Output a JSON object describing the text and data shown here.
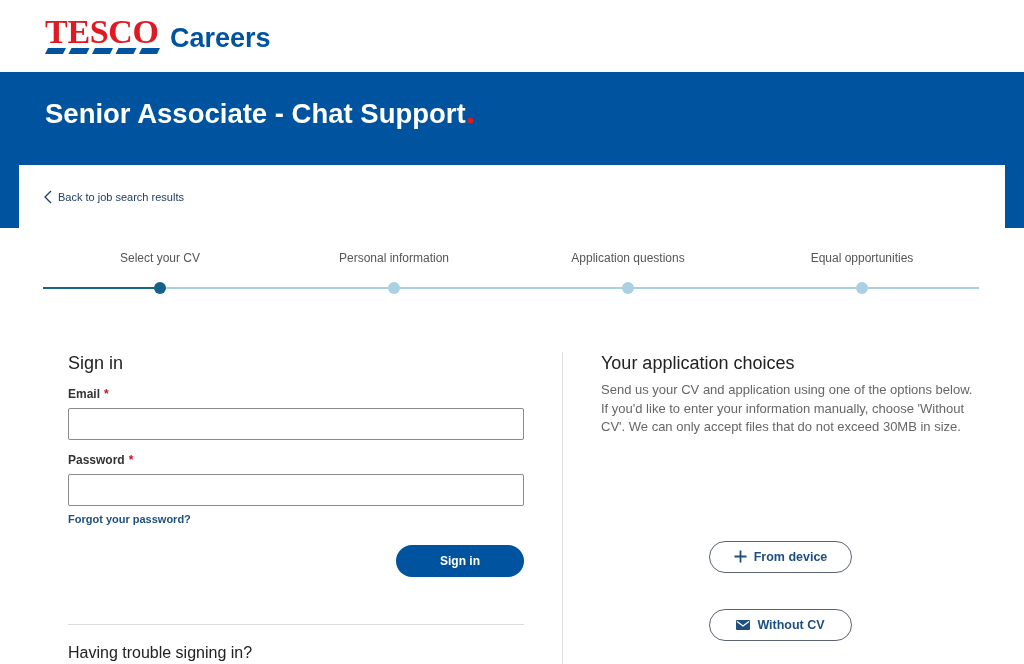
{
  "header": {
    "logo": {
      "brand": "TESCO",
      "site": "Careers"
    }
  },
  "banner": {
    "title": "Senior Associate - Chat Support"
  },
  "back_link": {
    "label": "Back to job search results"
  },
  "steps": [
    {
      "label": "Select your CV",
      "selected": true
    },
    {
      "label": "Personal information",
      "selected": false
    },
    {
      "label": "Application questions",
      "selected": false
    },
    {
      "label": "Equal opportunities",
      "selected": false
    }
  ],
  "sign_in": {
    "heading": "Sign in",
    "fields": [
      {
        "label": "Email",
        "required_mark": "*"
      },
      {
        "label": "Password",
        "required_mark": "*"
      }
    ],
    "forgot_link": "Forgot your password?",
    "submit": "Sign in",
    "help_heading": "Having trouble signing in?"
  },
  "choices": {
    "heading": "Your application choices",
    "description": "Send us your CV and application using one of the options below. If you'd like to enter your information manually, choose 'Without CV'. We can only accept files that do not exceed 30MB in size.",
    "options": [
      {
        "kind": "upload",
        "label": "From device"
      },
      {
        "kind": "manual",
        "label": "Without CV"
      }
    ]
  }
}
